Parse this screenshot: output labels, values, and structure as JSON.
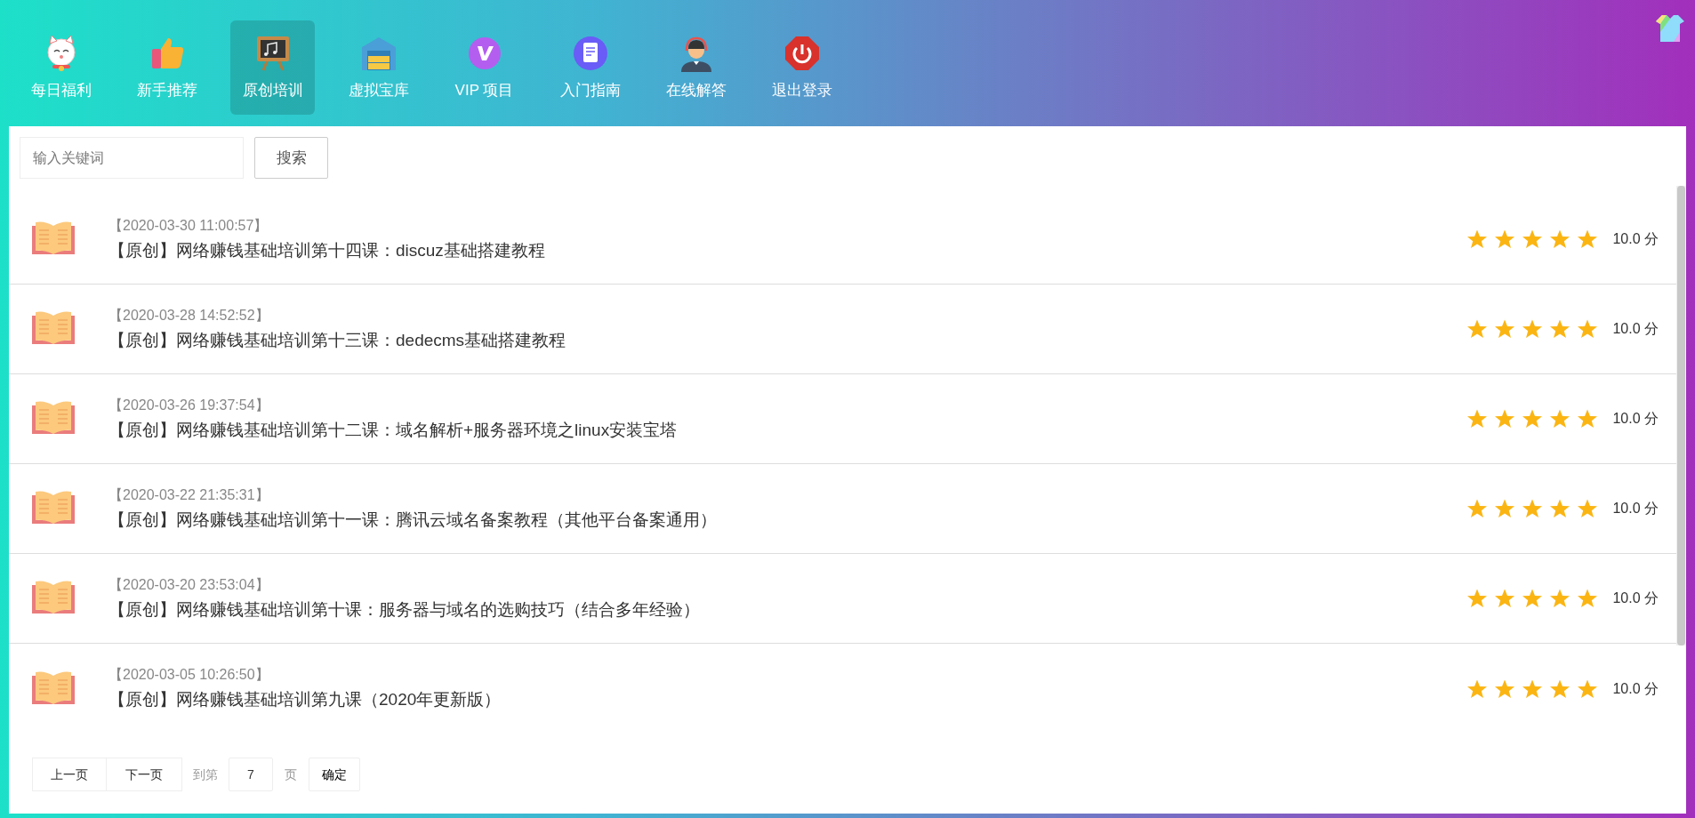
{
  "nav": [
    {
      "label": "每日福利",
      "selected": false
    },
    {
      "label": "新手推荐",
      "selected": false
    },
    {
      "label": "原创培训",
      "selected": true
    },
    {
      "label": "虚拟宝库",
      "selected": false
    },
    {
      "label": "VIP 项目",
      "selected": false
    },
    {
      "label": "入门指南",
      "selected": false
    },
    {
      "label": "在线解答",
      "selected": false
    },
    {
      "label": "退出登录",
      "selected": false
    }
  ],
  "search": {
    "placeholder": "输入关键词",
    "button": "搜索"
  },
  "articles": [
    {
      "date": "【2020-03-30 11:00:57】",
      "title": "【原创】网络赚钱基础培训第十四课：discuz基础搭建教程",
      "stars": 5,
      "score": "10.0 分"
    },
    {
      "date": "【2020-03-28 14:52:52】",
      "title": "【原创】网络赚钱基础培训第十三课：dedecms基础搭建教程",
      "stars": 5,
      "score": "10.0 分"
    },
    {
      "date": "【2020-03-26 19:37:54】",
      "title": "【原创】网络赚钱基础培训第十二课：域名解析+服务器环境之linux安装宝塔",
      "stars": 5,
      "score": "10.0 分"
    },
    {
      "date": "【2020-03-22 21:35:31】",
      "title": "【原创】网络赚钱基础培训第十一课：腾讯云域名备案教程（其他平台备案通用）",
      "stars": 5,
      "score": "10.0 分"
    },
    {
      "date": "【2020-03-20 23:53:04】",
      "title": "【原创】网络赚钱基础培训第十课：服务器与域名的选购技巧（结合多年经验）",
      "stars": 5,
      "score": "10.0 分"
    },
    {
      "date": "【2020-03-05 10:26:50】",
      "title": "【原创】网络赚钱基础培训第九课（2020年更新版）",
      "stars": 5,
      "score": "10.0 分"
    }
  ],
  "pagination": {
    "prev": "上一页",
    "next": "下一页",
    "goto_label": "到第",
    "page_value": "7",
    "page_suffix": "页",
    "confirm": "确定"
  }
}
